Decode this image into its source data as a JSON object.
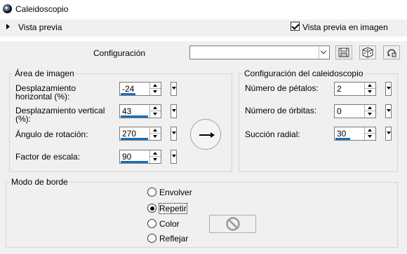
{
  "window": {
    "title": "Caleidoscopio",
    "icon": "kaleidoscope-app-icon"
  },
  "preview": {
    "expand_label": "Vista previa",
    "checkbox_label": "Vista previa en imagen",
    "checked": true
  },
  "config": {
    "label": "Configuración",
    "value": "",
    "save_icon": "save-icon",
    "random_icon": "dice-icon",
    "reset_icon": "reset-icon"
  },
  "image_area": {
    "title": "Área de imagen",
    "h_offset_label_line1": "Desplazamiento",
    "h_offset_label_line2": "horizontal (%):",
    "h_offset": "-24",
    "v_offset_label_line1": "Desplazamiento vertical",
    "v_offset_label_line2": "(%):",
    "v_offset": "43",
    "rotation_label": "Ángulo de rotación:",
    "rotation": "270",
    "scale_label": "Factor de escala:",
    "scale": "90"
  },
  "kaleido": {
    "title": "Configuración del caleidoscopio",
    "petals_label": "Número de pétalos:",
    "petals": "2",
    "orbits_label": "Número de órbitas:",
    "orbits": "0",
    "suction_label": "Succión radial:",
    "suction": "30"
  },
  "edge_mode": {
    "title": "Modo de borde",
    "options": [
      "Envolver",
      "Repetir",
      "Color",
      "Reflejar"
    ],
    "selected": "Repetir",
    "color_icon": "no-color-icon"
  }
}
